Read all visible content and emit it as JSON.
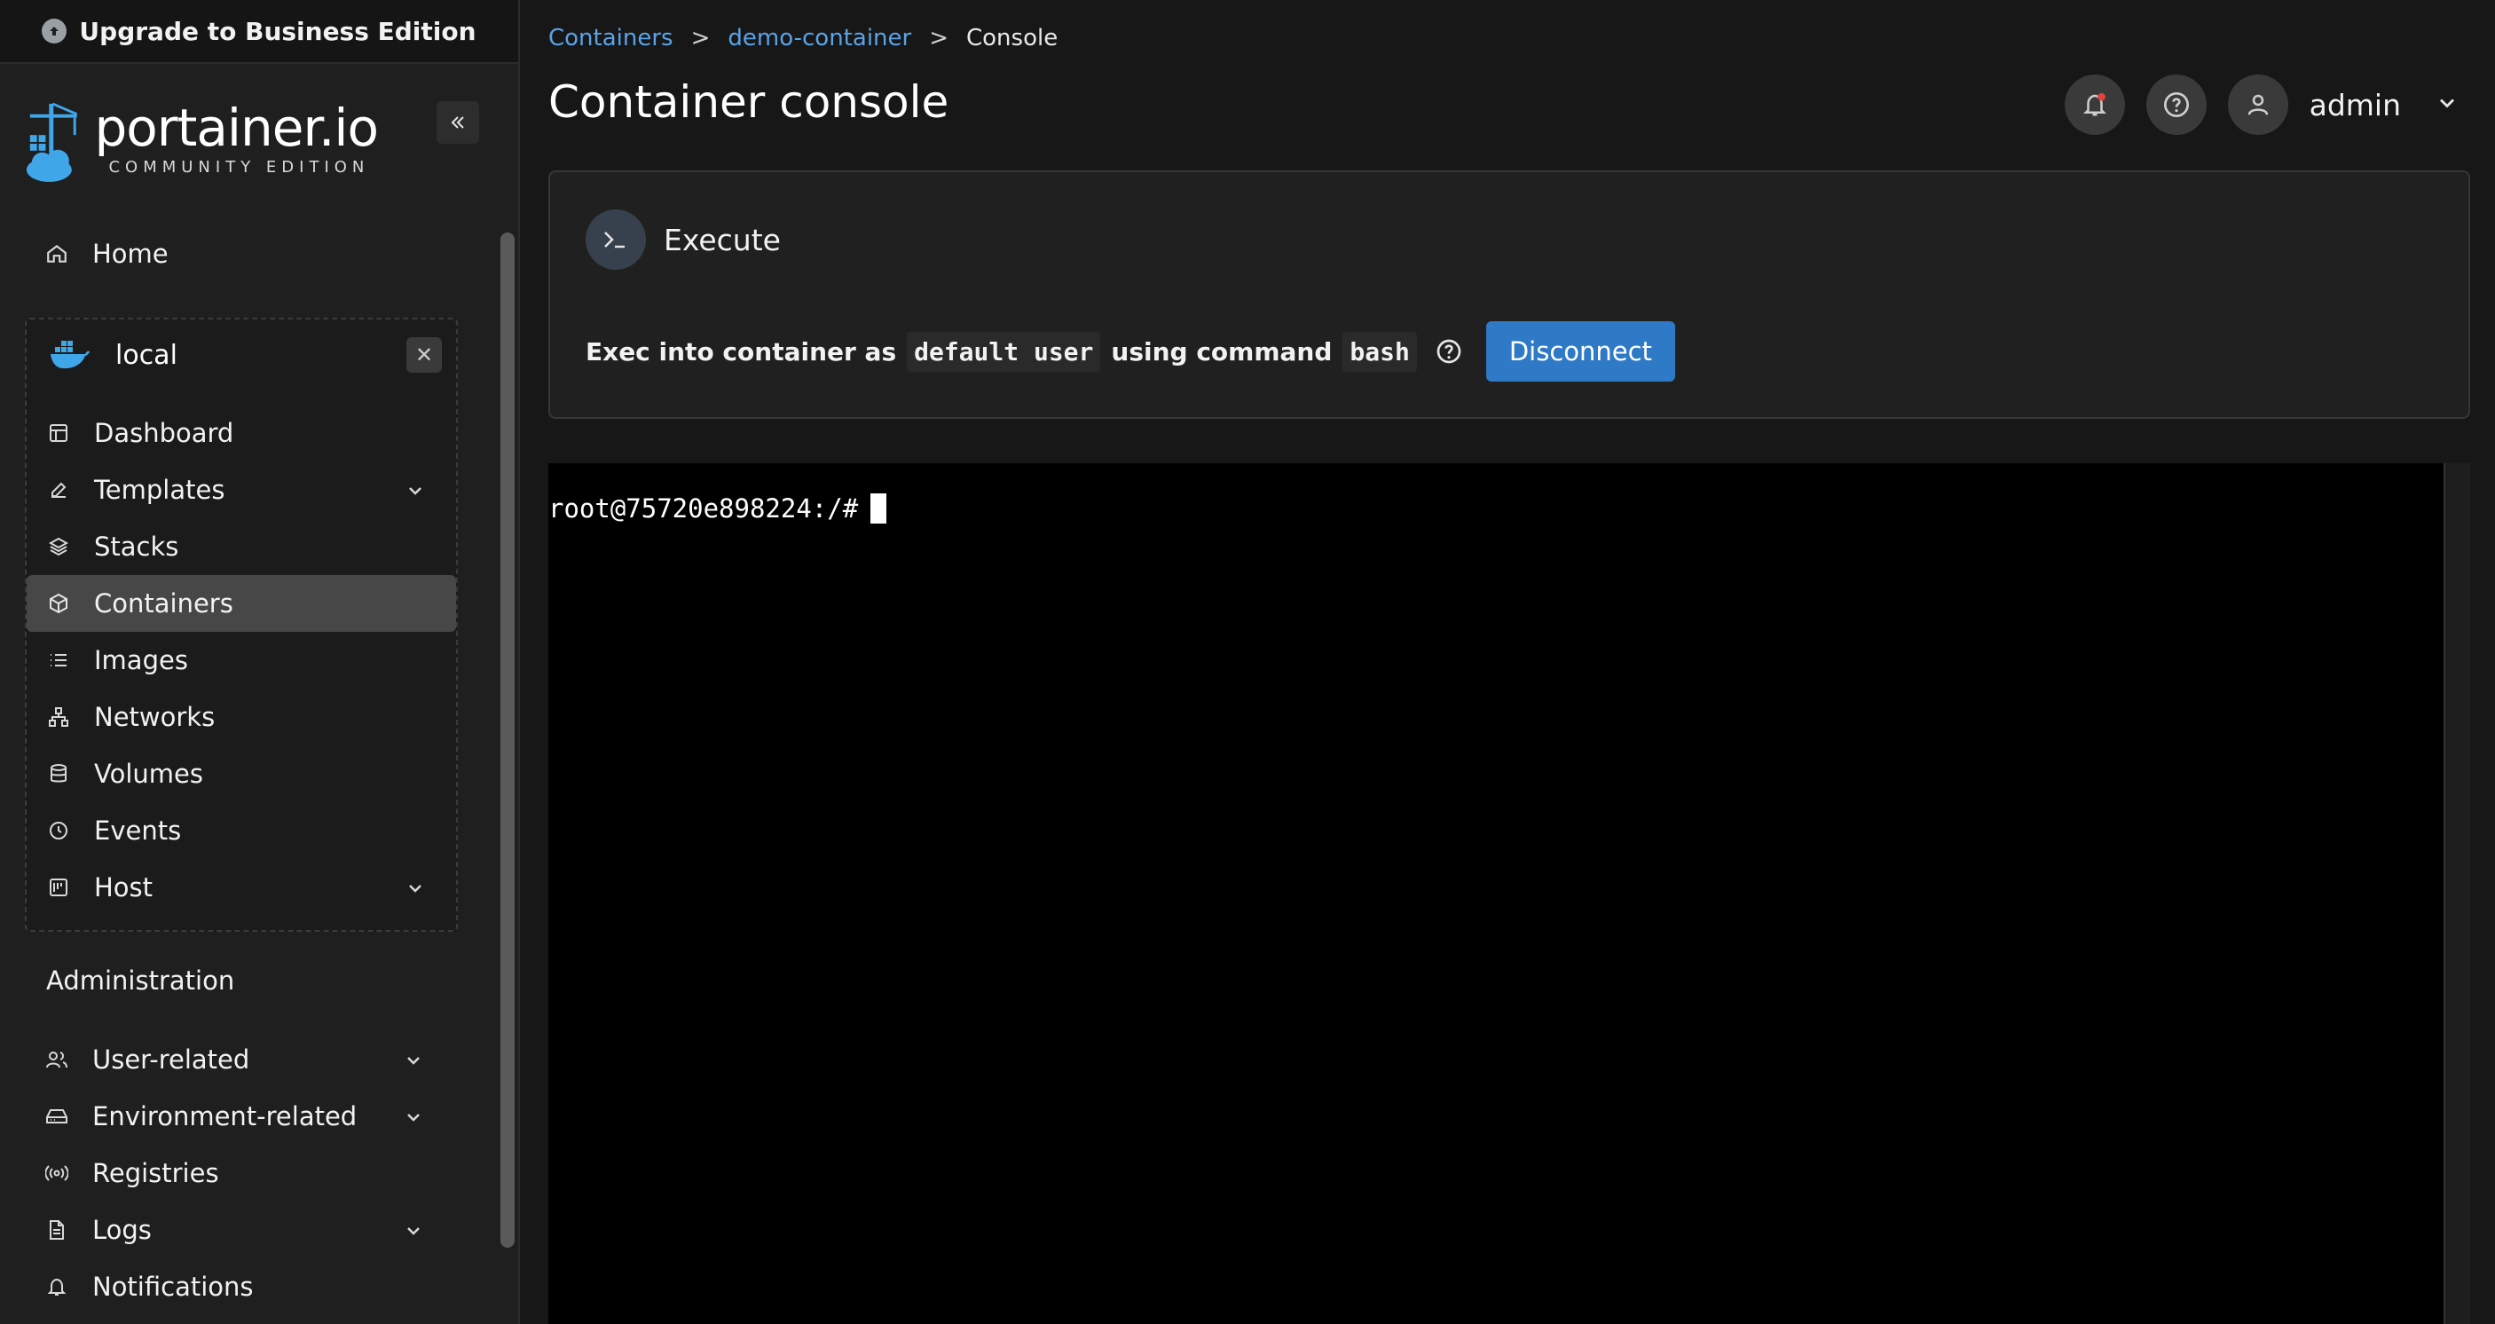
{
  "upgrade": {
    "label": "Upgrade to Business Edition"
  },
  "brand": {
    "name": "portainer.io",
    "edition": "COMMUNITY EDITION"
  },
  "sidebar": {
    "home": "Home",
    "environment": {
      "name": "local"
    },
    "env_items": [
      {
        "label": "Dashboard",
        "icon": "dashboard-icon"
      },
      {
        "label": "Templates",
        "icon": "edit-icon",
        "expandable": true
      },
      {
        "label": "Stacks",
        "icon": "layers-icon"
      },
      {
        "label": "Containers",
        "icon": "box-icon",
        "active": true
      },
      {
        "label": "Images",
        "icon": "list-icon"
      },
      {
        "label": "Networks",
        "icon": "network-icon"
      },
      {
        "label": "Volumes",
        "icon": "database-icon"
      },
      {
        "label": "Events",
        "icon": "clock-icon"
      },
      {
        "label": "Host",
        "icon": "host-icon",
        "expandable": true
      }
    ],
    "admin_title": "Administration",
    "admin_items": [
      {
        "label": "User-related",
        "icon": "users-icon",
        "expandable": true
      },
      {
        "label": "Environment-related",
        "icon": "hdd-icon",
        "expandable": true
      },
      {
        "label": "Registries",
        "icon": "radio-icon"
      },
      {
        "label": "Logs",
        "icon": "file-icon",
        "expandable": true
      },
      {
        "label": "Notifications",
        "icon": "bell-icon"
      }
    ]
  },
  "breadcrumb": {
    "containers": "Containers",
    "container": "demo-container",
    "current": "Console",
    "sep": ">"
  },
  "page": {
    "title": "Container console"
  },
  "user": {
    "name": "admin"
  },
  "execute": {
    "title": "Execute",
    "line_prefix": "Exec into container as",
    "user_code": "default user",
    "middle": "using command",
    "command_code": "bash",
    "disconnect_label": "Disconnect"
  },
  "terminal": {
    "prompt": "root@75720e898224:/#"
  },
  "colors": {
    "accent": "#2f7ac6",
    "link": "#5aa3e6",
    "notification_dot": "#e0433a"
  }
}
